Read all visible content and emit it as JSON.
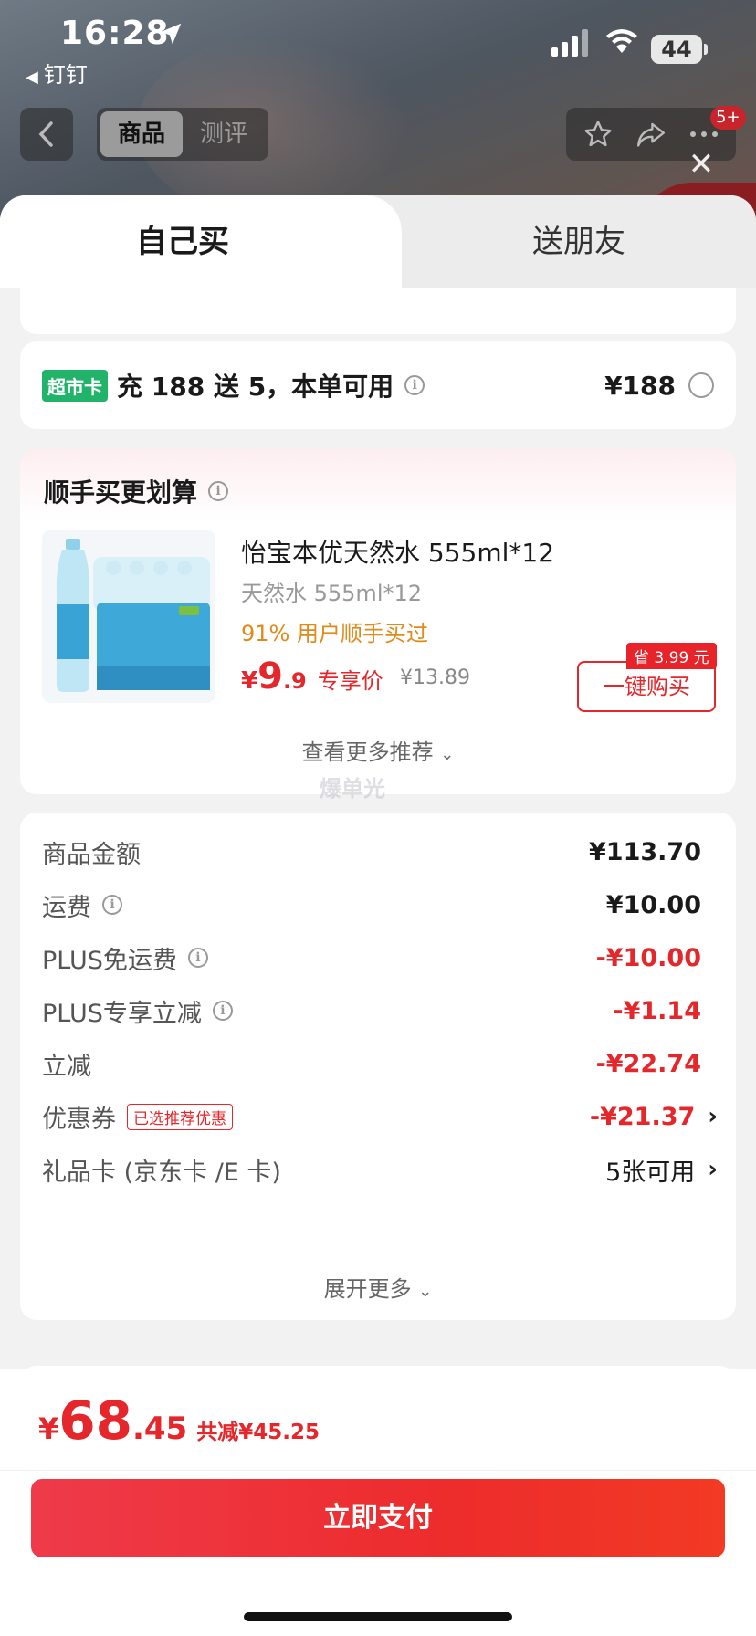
{
  "status": {
    "time": "16:28",
    "back_app": "钉钉",
    "battery": "44"
  },
  "nav": {
    "seg_goods": "商品",
    "seg_review": "测评",
    "badge": "5+"
  },
  "tabs": {
    "self": "自己买",
    "gift": "送朋友"
  },
  "market": {
    "badge": "超市卡",
    "text": "充 188 送 5，本单可用",
    "price": "¥188"
  },
  "recommend": {
    "title": "顺手买更划算",
    "name": "怡宝本优天然水 555ml*12",
    "spec": "天然水 555ml*12",
    "stat": "91% 用户顺手买过",
    "price_symbol": "¥",
    "price_int": "9",
    "price_dec": ".9",
    "price_label": "专享价",
    "orig": "¥13.89",
    "save_tag": "省 3.99 元",
    "buy": "一键购买",
    "more": "查看更多推荐"
  },
  "detail": {
    "rows": [
      {
        "label": "商品金额",
        "value": "¥113.70"
      },
      {
        "label": "运费",
        "value": "¥10.00"
      },
      {
        "label": "PLUS免运费",
        "value": "-¥10.00"
      },
      {
        "label": "PLUS专享立减",
        "value": "-¥1.14"
      },
      {
        "label": "立减",
        "value": "-¥22.74"
      },
      {
        "label": "优惠券",
        "tag": "已选推荐优惠",
        "value": "-¥21.37"
      },
      {
        "label": "礼品卡 (京东卡 /E 卡)",
        "value": "5张可用"
      }
    ],
    "expand": "展开更多"
  },
  "bottom": {
    "symbol": "¥",
    "int": "68",
    "dec": ".45",
    "off": "共减¥45.25",
    "pay": "立即支付"
  },
  "watermark": "爆单光",
  "colors": {
    "accent": "#e5262a",
    "market_badge": "#21b36a",
    "stat_orange": "#e08a1a"
  }
}
